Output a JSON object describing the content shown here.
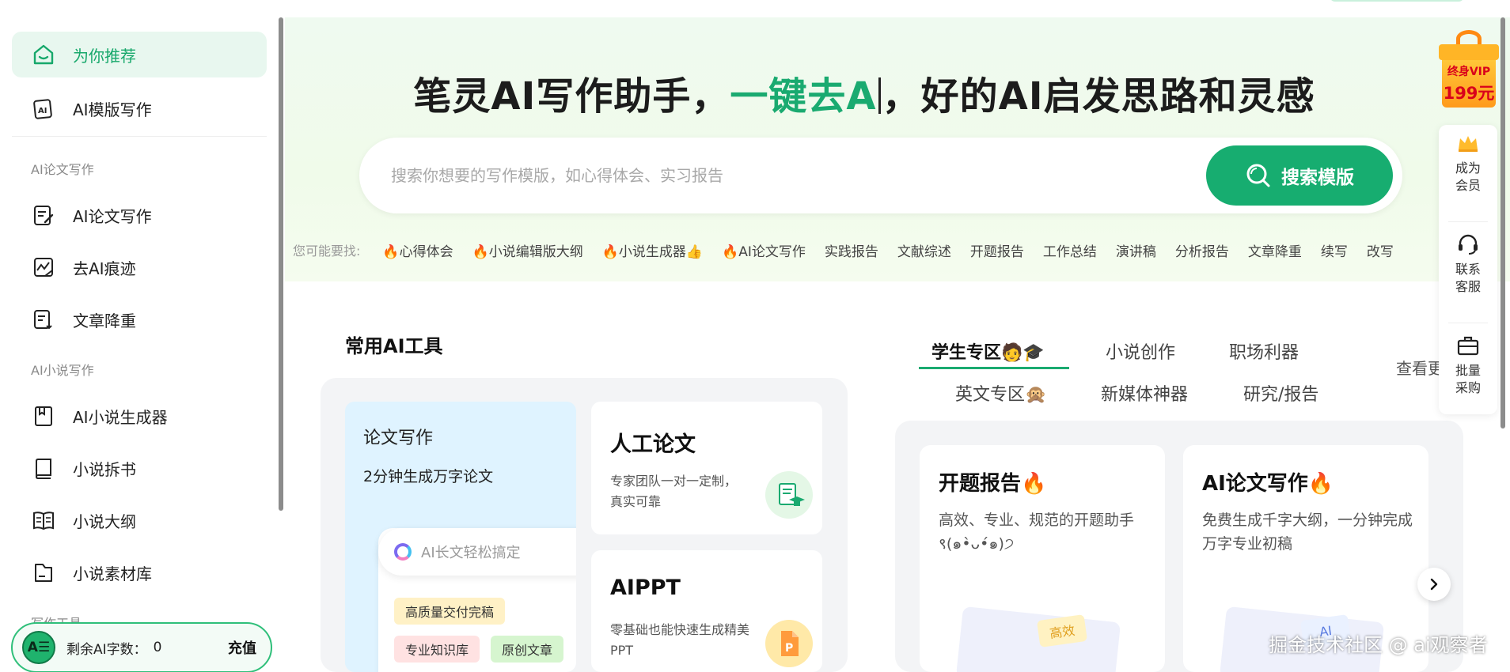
{
  "sidebar": {
    "items": [
      {
        "label": "为你推荐"
      },
      {
        "label": "AI模版写作"
      },
      {
        "label": "AI论文写作"
      },
      {
        "label": "去AI痕迹"
      },
      {
        "label": "文章降重"
      },
      {
        "label": "AI小说生成器"
      },
      {
        "label": "小说拆书"
      },
      {
        "label": "小说大纲"
      },
      {
        "label": "小说素材库"
      }
    ],
    "sections": [
      "AI论文写作",
      "AI小说写作",
      "写作工具"
    ],
    "footer": {
      "avatar": "A☰",
      "remain_label": "剩余AI字数：",
      "remain_value": "0",
      "charge": "充值"
    }
  },
  "hero": {
    "title_a": "笔灵AI写作助手，",
    "title_b": "一键去A",
    "title_c": "，好的AI启发思路和灵感",
    "search_placeholder": "搜索你想要的写作模版，如心得体会、实习报告",
    "search_button": "搜索模版",
    "hot_label": "您可能要找:",
    "hot_tags": [
      "心得体会",
      "小说编辑版大纲",
      "小说生成器👍",
      "AI论文写作",
      "实践报告",
      "文献综述",
      "开题报告",
      "工作总结",
      "演讲稿",
      "分析报告",
      "文章降重",
      "续写",
      "改写"
    ],
    "hot_fire": [
      true,
      true,
      true,
      true,
      false,
      false,
      false,
      false,
      false,
      false,
      false,
      false,
      false
    ]
  },
  "tools": {
    "title": "常用AI工具",
    "paper": {
      "title": "论文写作",
      "subtitle": "2分钟生成万字论文",
      "ai_text": "AI长文轻松搞定",
      "chips": [
        "高质量交付完稿",
        "专业知识库",
        "原创文章"
      ]
    },
    "manual": {
      "title": "人工论文",
      "desc": "专家团队一对一定制，真实可靠"
    },
    "ppt": {
      "title": "AIPPT",
      "desc": "零基础也能快速生成精美PPT"
    }
  },
  "tabs": [
    "学生专区🧑🎓",
    "小说创作",
    "职场利器",
    "英文专区🙊",
    "新媒体神器",
    "研究/报告"
  ],
  "see_more": "查看更",
  "features": [
    {
      "title": "开题报告🔥",
      "desc": "高效、专业、规范的开题助手 ९(๑•̀ᴗ•́๑)੭",
      "badge": "高效"
    },
    {
      "title": "AI论文写作🔥",
      "desc": "免费生成千字大纲，一分钟完成万字专业初稿",
      "badge": "AI"
    }
  ],
  "float": {
    "vip_t1": "终身VIP",
    "vip_t2": "199元",
    "items": [
      "成为会员",
      "联系客服",
      "批量采购"
    ]
  },
  "watermark": "掘金技术社区 @ ai观察者",
  "colors": {
    "accent": "#17ad70",
    "vip": "#d9001b"
  }
}
